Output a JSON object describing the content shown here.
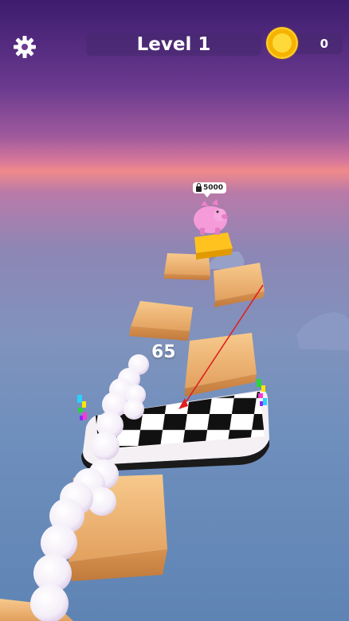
{
  "hud": {
    "level_label": "Level 1",
    "coin_count": "0",
    "settings_icon": "gear-icon",
    "coin_icon": "coin-icon"
  },
  "reward": {
    "price": "5000",
    "lock_icon": "lock-icon",
    "item": "pink piggy bank"
  },
  "game": {
    "ball_count": "65"
  },
  "colors": {
    "sky_top": "#3d1c6e",
    "horizon_glow": "#f08a8a",
    "sky_bottom": "#5e84b4",
    "wood": "#f0b978",
    "coin": "#ffcf2a",
    "aim_line": "#e02020"
  }
}
